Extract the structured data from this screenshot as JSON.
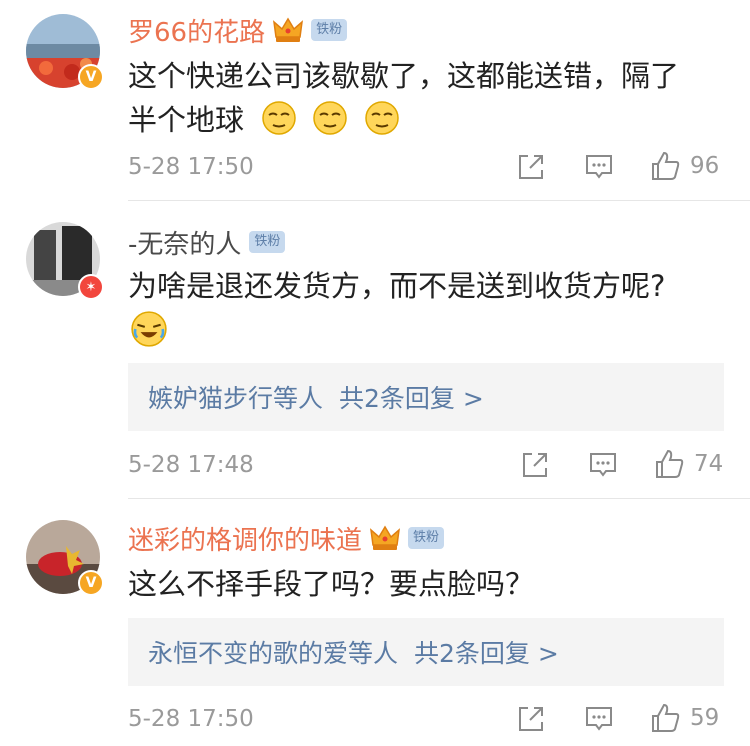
{
  "comments": [
    {
      "username": "罗66的花路",
      "fan_badge": "铁粉",
      "text_line1": "这个快递公司该歇歇了，这都能送错，隔了",
      "text_line2": "半个地球",
      "time": "5-28 17:50",
      "likes": "96",
      "verify": "V"
    },
    {
      "username": "-无奈的人",
      "fan_badge": "铁粉",
      "text_line1": "为啥是退还发货方，而不是送到收货方呢?",
      "reply_names": "嫉妒猫步行",
      "reply_mid": "等人",
      "reply_count": "共2条回复 >",
      "time": "5-28 17:48",
      "likes": "74",
      "verify": "✶"
    },
    {
      "username": "迷彩的格调你的味道",
      "fan_badge": "铁粉",
      "text_line1": "这么不择手段了吗？要点脸吗？",
      "reply_names": "永恒不变的歌的爱",
      "reply_mid": "等人",
      "reply_count": "共2条回复 >",
      "time": "5-28 17:50",
      "likes": "59",
      "verify": "V"
    }
  ],
  "colors": {
    "vip_name": "#eb7350",
    "link": "#5b7ba4",
    "meta": "#9a9a9a",
    "badge_bg": "#c6d9ee"
  },
  "icons": [
    "crown-icon",
    "forward-icon",
    "comment-icon",
    "like-icon",
    "emoji-icon"
  ]
}
